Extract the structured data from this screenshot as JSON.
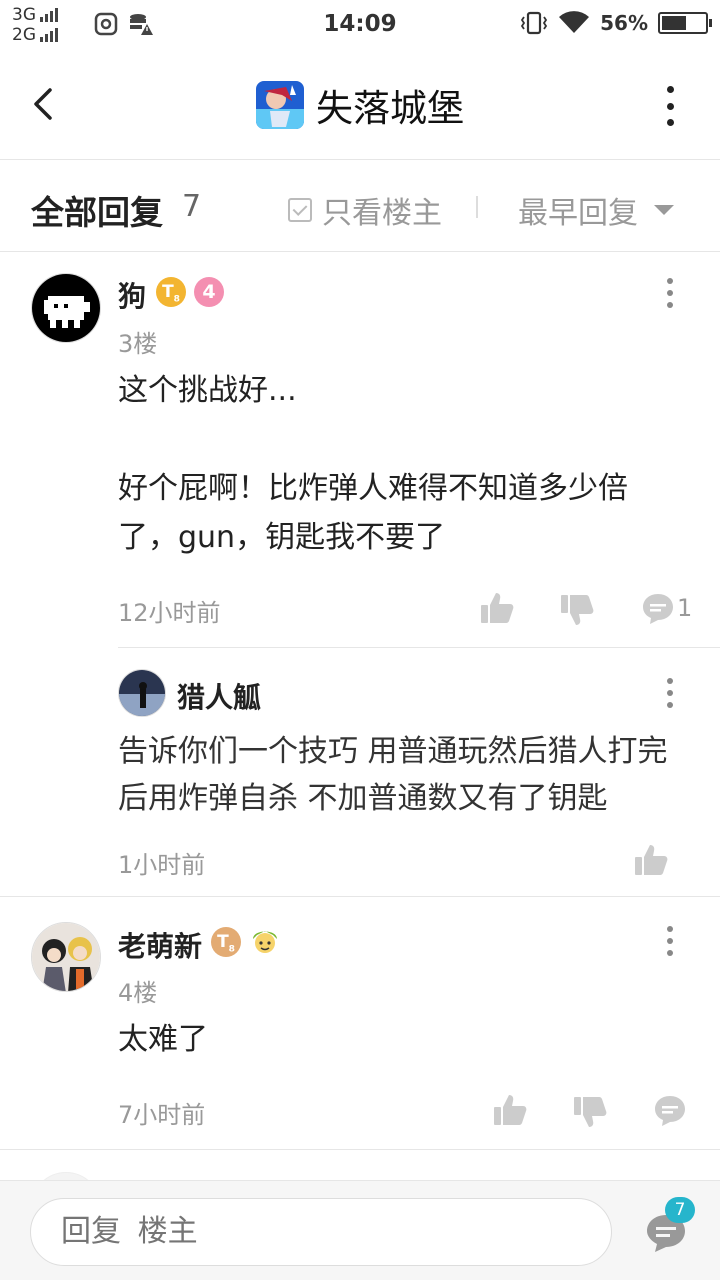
{
  "status_bar": {
    "network_top": "3G",
    "network_bottom": "2G",
    "time": "14:09",
    "battery": "56%",
    "battery_level": 0.56
  },
  "header": {
    "title": "失落城堡"
  },
  "filter": {
    "all_replies_label": "全部回复",
    "all_replies_count": "7",
    "only_op_label": "只看楼主",
    "sort_label": "最早回复"
  },
  "posts": [
    {
      "username": "狗",
      "floor": "3楼",
      "level": "4",
      "content_line1": "这个挑战好...",
      "content_line2": "好个屁啊！比炸弹人难得不知道多少倍",
      "content_line3": "了，gun，钥匙我不要了",
      "time": "12小时前",
      "reply_count": "1"
    },
    {
      "username": "老萌新",
      "floor": "4楼",
      "content_line1": "太难了",
      "time": "7小时前"
    }
  ],
  "sub_reply": {
    "username": "猎人觚",
    "content_line1": "告诉你们一个技巧 用普通玩然后猎人打完",
    "content_line2": "后用炸弹自杀 不加普通数又有了钥匙",
    "time": "1小时前"
  },
  "bottom": {
    "reply_placeholder": "回复  楼主",
    "reply_badge": "7"
  },
  "colors": {
    "accent": "#26b5cc",
    "badge_gold": "#f3b531",
    "badge_pink": "#f48fb1"
  }
}
